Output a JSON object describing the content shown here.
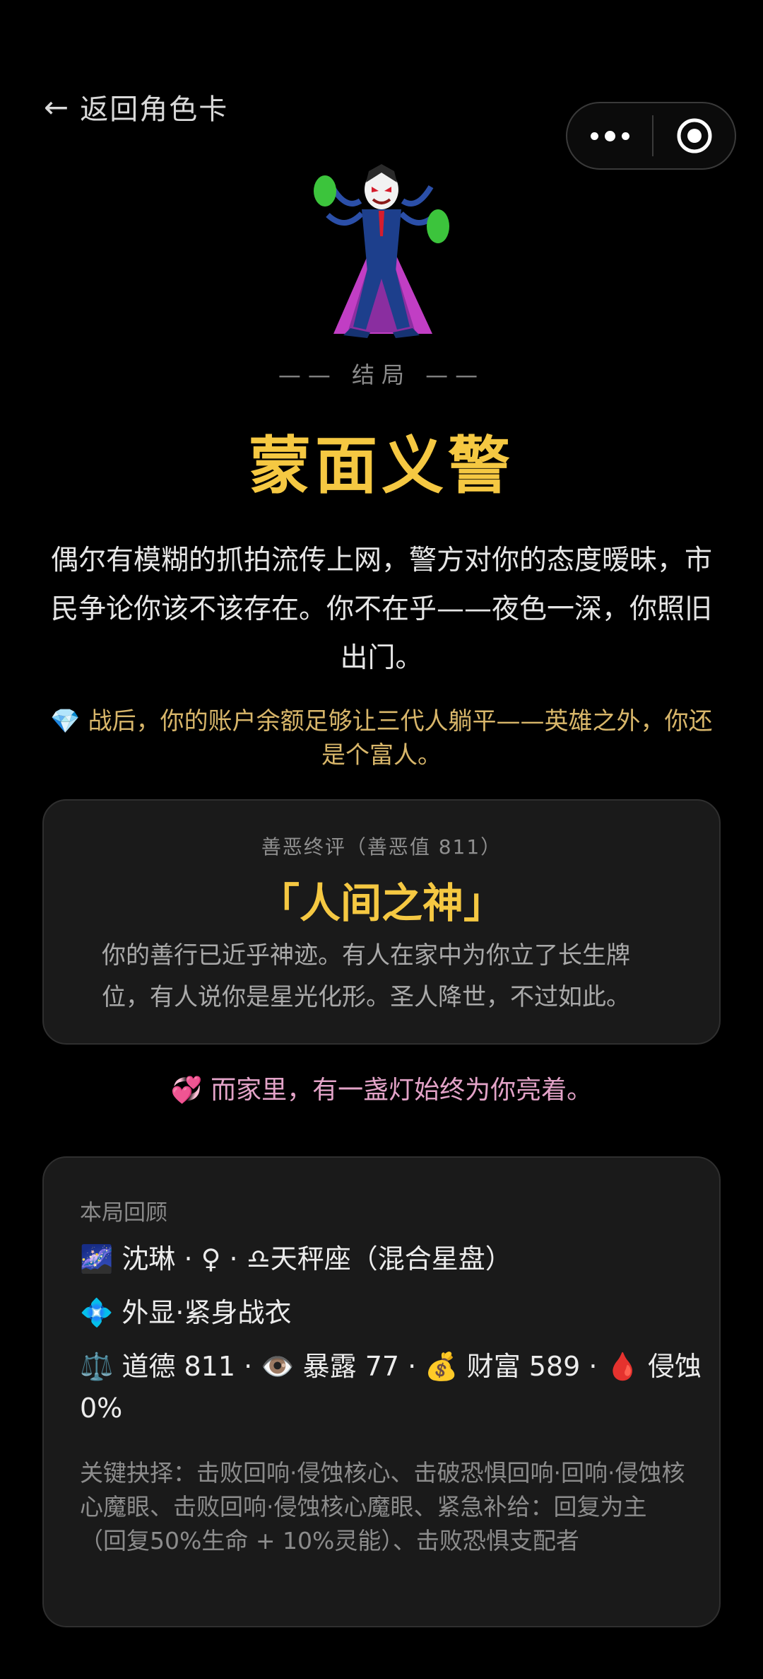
{
  "nav": {
    "back_arrow": "←",
    "back_label": "返回角色卡",
    "menu_icon": "more-dots-icon",
    "close_icon": "target-circle-icon"
  },
  "hero": {
    "icon": "supervillain-emoji-icon"
  },
  "ending": {
    "label": "—— 结局 ——",
    "title": "蒙面义警",
    "description": "偶尔有模糊的抓拍流传上网，警方对你的态度暧昧，市民争论你该不该存在。你不在乎——夜色一深，你照旧出门。",
    "wealth_note": "💎 战后，你的账户余额足够让三代人躺平——英雄之外，你还是个富人。"
  },
  "verdict": {
    "caption": "善恶终评（善恶值 811）",
    "title": "「人间之神」",
    "text": "你的善行已近乎神迹。有人在家中为你立了长生牌位，有人说你是星光化形。圣人降世，不过如此。"
  },
  "family_note": "💞 而家里，有一盏灯始终为你亮着。",
  "recap": {
    "title": "本局回顾",
    "identity": "🌌 沈琳 · ♀ · ♎天秤座（混合星盘）",
    "appearance": "💠 外显·紧身战衣",
    "stats": "⚖️ 道德 811 · 👁️ 暴露 77 · 💰 财富 589 · 🩸 侵蚀 0%",
    "key_choices": "关键抉择：击败回响·侵蚀核心、击破恐惧回响·回响·侵蚀核心魔眼、击败回响·侵蚀核心魔眼、紧急补给：回复为主（回复50%生命 + 10%灵能）、击败恐惧支配者"
  },
  "colors": {
    "background": "#000000",
    "accent_gold": "#f5c842",
    "wealth_text": "#d8b66a",
    "family_text": "#e3a3c8",
    "card_bg": "#1a1a1a"
  }
}
